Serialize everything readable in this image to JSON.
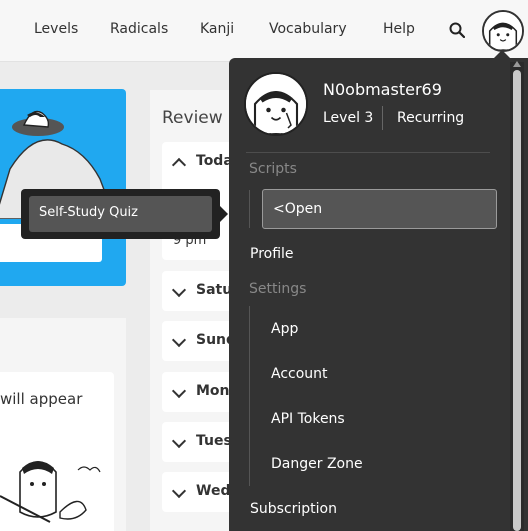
{
  "nav": {
    "items": [
      {
        "label": "Levels"
      },
      {
        "label": "Radicals"
      },
      {
        "label": "Kanji"
      },
      {
        "label": "Vocabulary"
      },
      {
        "label": "Help"
      }
    ],
    "search_icon": "search-icon",
    "avatar_icon": "user-avatar"
  },
  "background": {
    "review_heading": "Review F",
    "time_label": "9 pm",
    "appear_text": "will appear",
    "days": [
      "Today",
      "Satur",
      "Sund",
      "Mond",
      "Tues",
      "Wedn"
    ]
  },
  "tooltip": {
    "text": "Self-Study Quiz"
  },
  "dropdown": {
    "username": "N0obmaster69",
    "level": "Level 3",
    "subscription_status": "Recurring",
    "scripts_heading": "Scripts",
    "scripts_input_value": "<Open",
    "profile_label": "Profile",
    "settings_heading": "Settings",
    "settings_items": [
      "App",
      "Account",
      "API Tokens",
      "Danger Zone"
    ],
    "subscription_label": "Subscription"
  },
  "colors": {
    "accent_blue": "#20a8f0",
    "dropdown_bg": "#333333",
    "tooltip_bg": "#222222"
  }
}
